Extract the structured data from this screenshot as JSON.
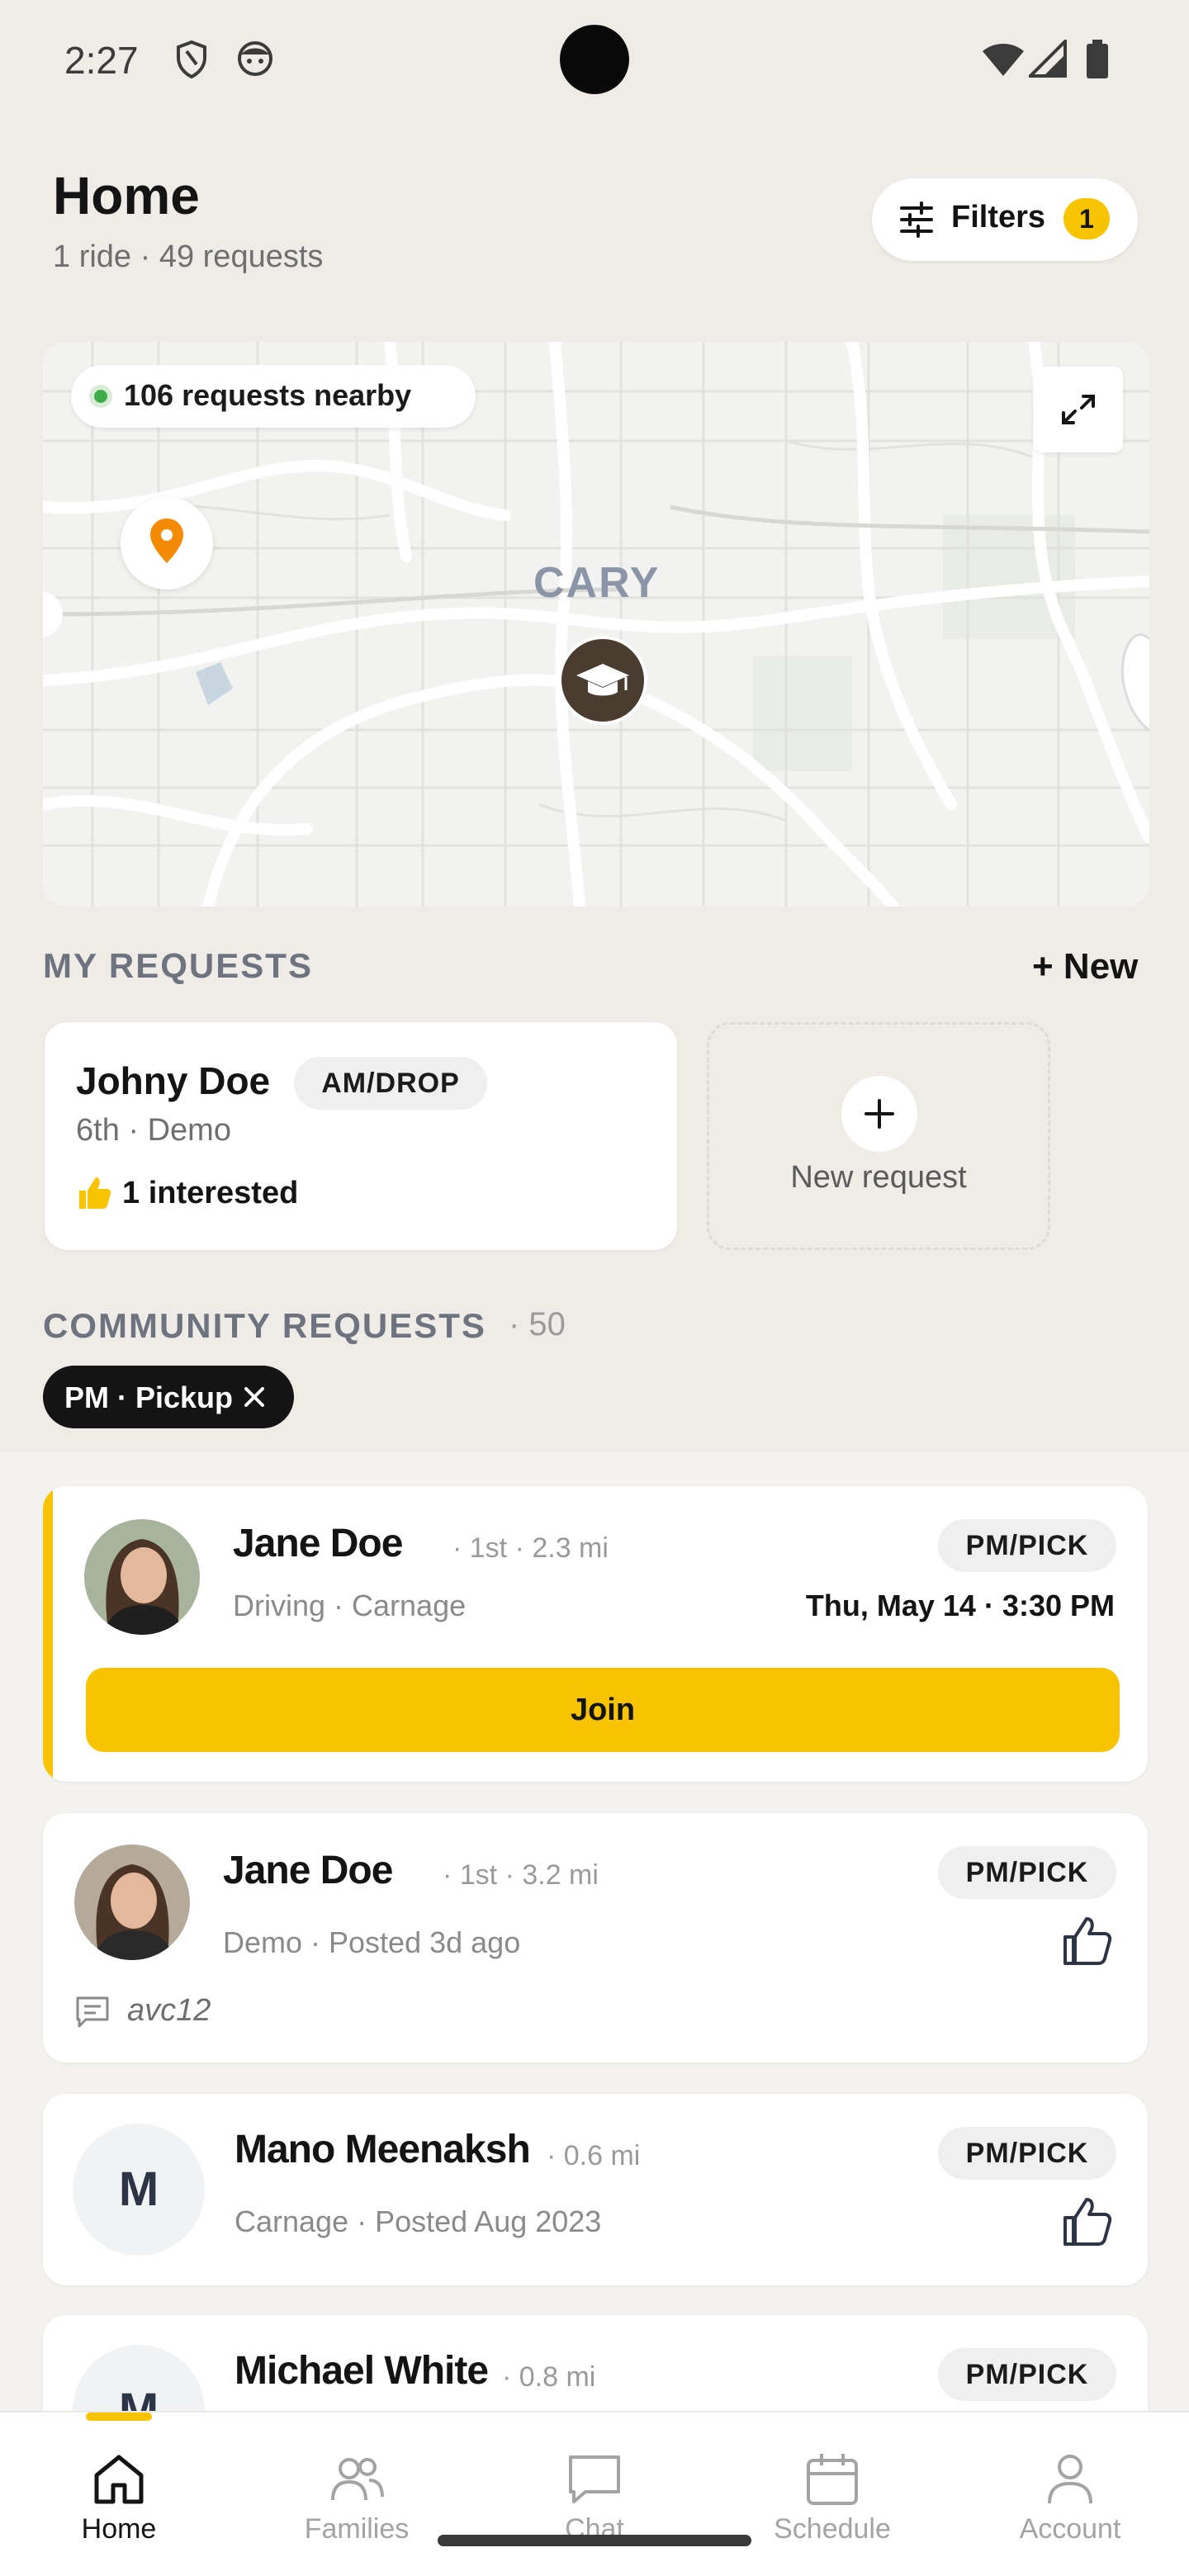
{
  "status_bar": {
    "time": "2:27"
  },
  "header": {
    "title": "Home",
    "subtitle": "1 ride · 49 requests",
    "filters_label": "Filters",
    "filters_count": "1"
  },
  "map": {
    "nearby_text": "106 requests nearby",
    "area_label": "CARY"
  },
  "my_requests": {
    "section_title": "MY REQUESTS",
    "new_link": "+ New",
    "card": {
      "name": "Johny Doe",
      "tag": "AM/DROP",
      "subtitle": "6th · Demo",
      "interest": "1 interested"
    },
    "new_request_label": "New request"
  },
  "community": {
    "section_title": "COMMUNITY REQUESTS",
    "count": "· 50",
    "chip_label": "PM · Pickup",
    "requests": [
      {
        "name": "Jane Doe",
        "meta": "· 1st · 2.3 mi",
        "subtitle": "Driving · Carnage",
        "tag": "PM/PICK",
        "when": "Thu, May 14 · 3:30 PM",
        "action_label": "Join"
      },
      {
        "name": "Jane Doe",
        "meta": "· 1st · 3.2 mi",
        "subtitle": "Demo · Posted 3d ago",
        "tag": "PM/PICK",
        "note": "avc12"
      },
      {
        "name": "Mano Meenaksh",
        "initial": "M",
        "meta": "· 0.6 mi",
        "subtitle": "Carnage · Posted Aug 2023",
        "tag": "PM/PICK"
      },
      {
        "name": "Michael White",
        "initial": "M",
        "meta": "· 0.8 mi",
        "tag": "PM/PICK"
      }
    ]
  },
  "bottom_nav": {
    "items": [
      {
        "label": "Home",
        "icon": "home-icon",
        "active": true
      },
      {
        "label": "Families",
        "icon": "families-icon"
      },
      {
        "label": "Chat",
        "icon": "chat-icon"
      },
      {
        "label": "Schedule",
        "icon": "calendar-icon"
      },
      {
        "label": "Account",
        "icon": "account-icon"
      }
    ]
  },
  "colors": {
    "accent": "#f8c300",
    "background": "#efece7",
    "card": "#ffffff",
    "text": "#141414",
    "muted": "#8a8a8a"
  }
}
